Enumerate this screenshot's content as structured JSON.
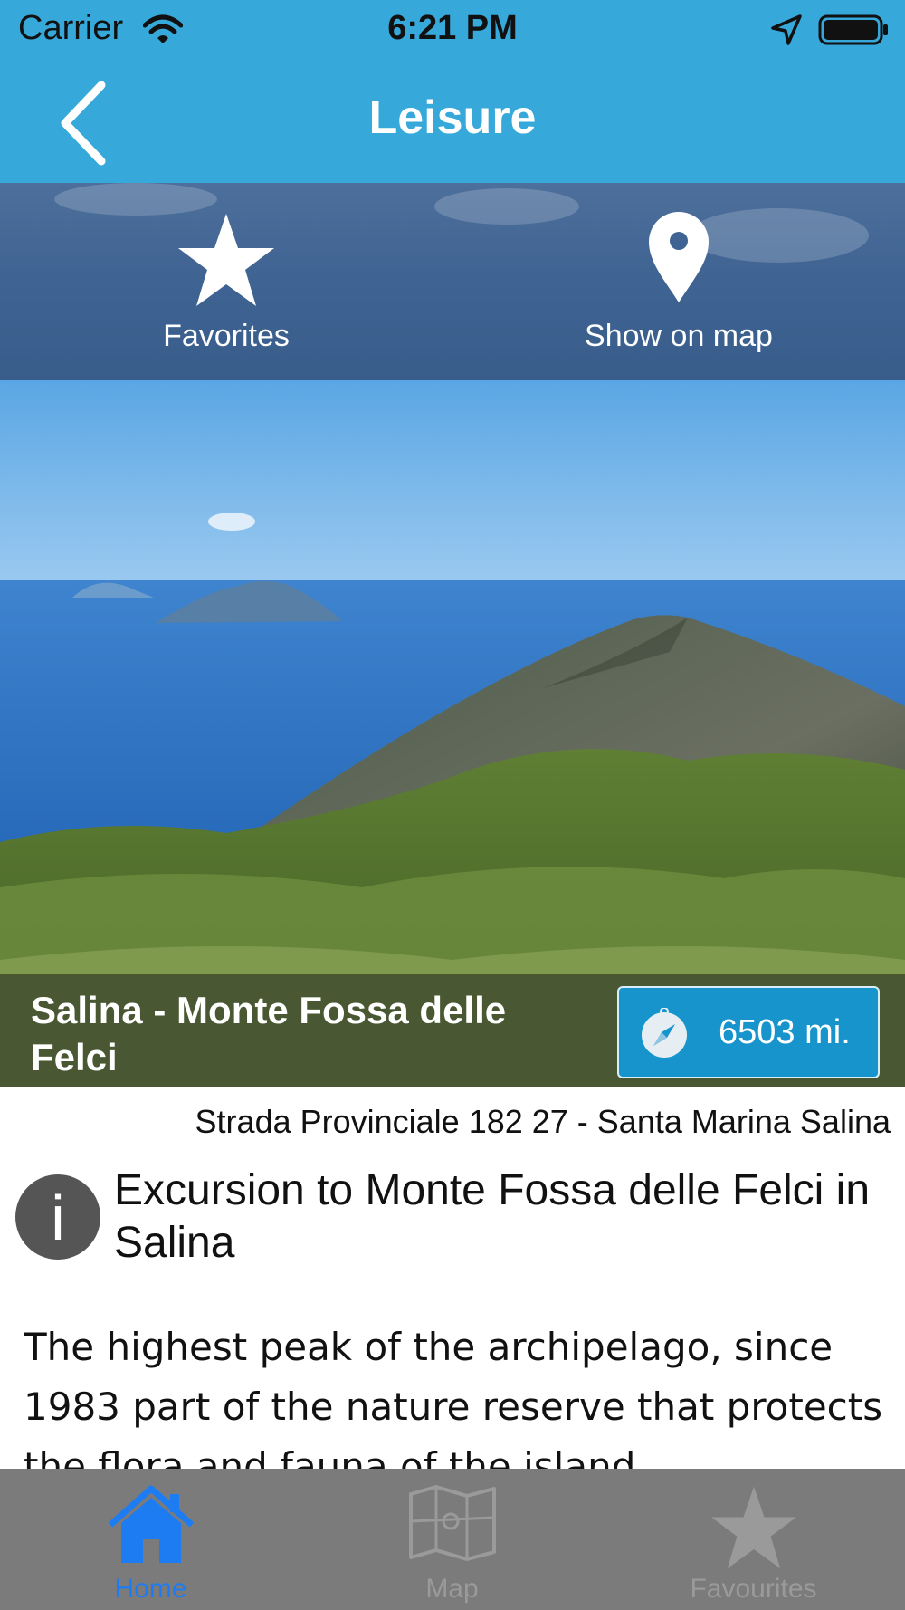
{
  "status_bar": {
    "carrier": "Carrier",
    "time": "6:21 PM"
  },
  "nav": {
    "title": "Leisure"
  },
  "actions": {
    "favorites": "Favorites",
    "show_on_map": "Show on map"
  },
  "place": {
    "name": "Salina - Monte Fossa delle Felci",
    "distance": "6503 mi.",
    "address": "Strada Provinciale 182 27  - Santa Marina Salina",
    "headline": "Excursion to Monte Fossa delle Felci in Salina",
    "description": "The highest peak of the archipelago, since 1983 part of the nature reserve that protects the flora and fauna of the island"
  },
  "info_icon_glyph": "i",
  "tabs": [
    {
      "label": "Home",
      "icon": "home-icon",
      "active": true
    },
    {
      "label": "Map",
      "icon": "map-icon",
      "active": false
    },
    {
      "label": "Favourites",
      "icon": "star-icon",
      "active": false
    }
  ],
  "colors": {
    "bar": "#36a8d9",
    "active_tab": "#1e7cf2",
    "tabbar": "#7b7b7b",
    "distance_bg": "#1794cc"
  }
}
